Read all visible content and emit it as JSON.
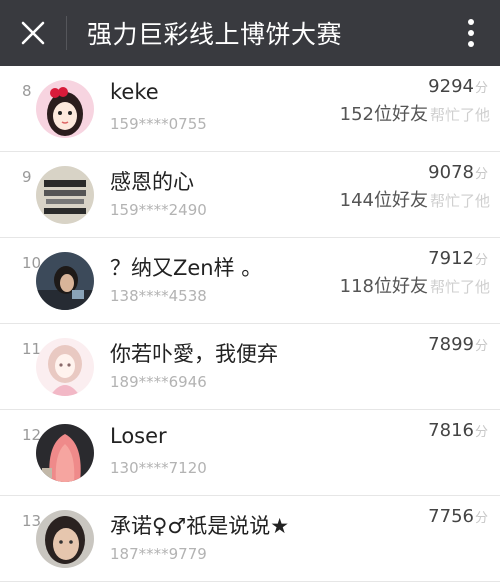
{
  "header": {
    "title": "强力巨彩线上博饼大赛",
    "close_icon": "close-icon",
    "menu_icon": "more-vertical-icon"
  },
  "rows": [
    {
      "rank": "8",
      "name": "keke",
      "phone": "159****0755",
      "score": "9294",
      "unit": "分",
      "helpers": "152位好友",
      "help_label": "帮忙了他"
    },
    {
      "rank": "9",
      "name": "感恩的心",
      "phone": "159****2490",
      "score": "9078",
      "unit": "分",
      "helpers": "144位好友",
      "help_label": "帮忙了他"
    },
    {
      "rank": "10",
      "name": "？纳又Zen样 。",
      "phone": "138****4538",
      "score": "7912",
      "unit": "分",
      "helpers": "118位好友",
      "help_label": "帮忙了他"
    },
    {
      "rank": "11",
      "name": "你若卟愛，我便弃",
      "phone": "189****6946",
      "score": "7899",
      "unit": "分"
    },
    {
      "rank": "12",
      "name": "Loser",
      "phone": "130****7120",
      "score": "7816",
      "unit": "分"
    },
    {
      "rank": "13",
      "name": "承诺♀♂祇是说说★",
      "phone": "187****9779",
      "score": "7756",
      "unit": "分"
    }
  ]
}
